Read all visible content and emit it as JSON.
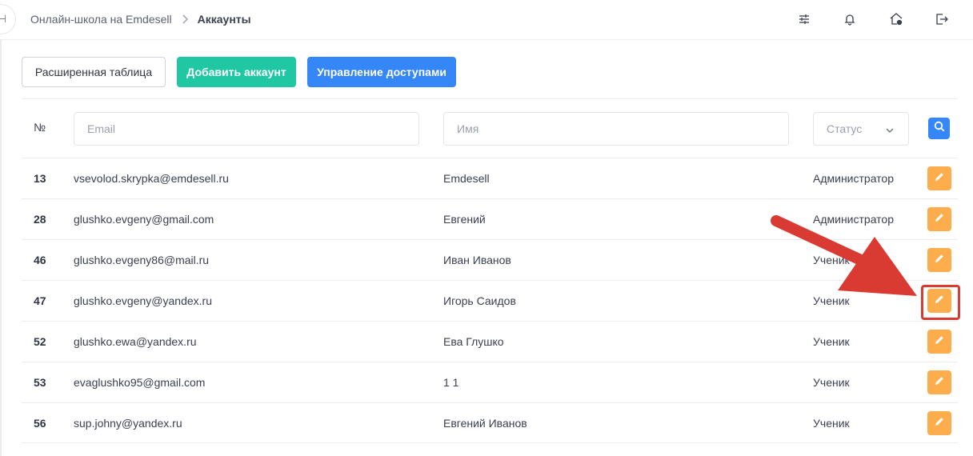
{
  "header": {
    "breadcrumb": {
      "parent": "Онлайн-школа на Emdesell",
      "current": "Аккаунты"
    },
    "icons": [
      "sliders-icon",
      "bell-icon",
      "home-settings-icon",
      "logout-icon"
    ]
  },
  "toolbar": {
    "extended_table": "Расширенная таблица",
    "add_account": "Добавить аккаунт",
    "manage_access": "Управление доступами"
  },
  "filters": {
    "number_header": "№",
    "email_placeholder": "Email",
    "name_placeholder": "Имя",
    "status_label": "Статус"
  },
  "rows": [
    {
      "id": "13",
      "email": "vsevolod.skrypka@emdesell.ru",
      "name": "Emdesell",
      "status": "Администратор"
    },
    {
      "id": "28",
      "email": "glushko.evgeny@gmail.com",
      "name": "Евгений",
      "status": "Администратор"
    },
    {
      "id": "46",
      "email": "glushko.evgeny86@mail.ru",
      "name": "Иван Иванов",
      "status": "Ученик"
    },
    {
      "id": "47",
      "email": "glushko.evgeny@yandex.ru",
      "name": "Игорь Саидов",
      "status": "Ученик"
    },
    {
      "id": "52",
      "email": "glushko.ewa@yandex.ru",
      "name": "Ева Глушко",
      "status": "Ученик"
    },
    {
      "id": "53",
      "email": "evaglushko95@gmail.com",
      "name": "1 1",
      "status": "Ученик"
    },
    {
      "id": "56",
      "email": "sup.johny@yandex.ru",
      "name": "Евгений Иванов",
      "status": "Ученик"
    }
  ],
  "colors": {
    "add_button": "#1fc7a2",
    "access_button": "#3586f7",
    "edit_button": "#fdad4b",
    "annotation": "#d93a32"
  }
}
